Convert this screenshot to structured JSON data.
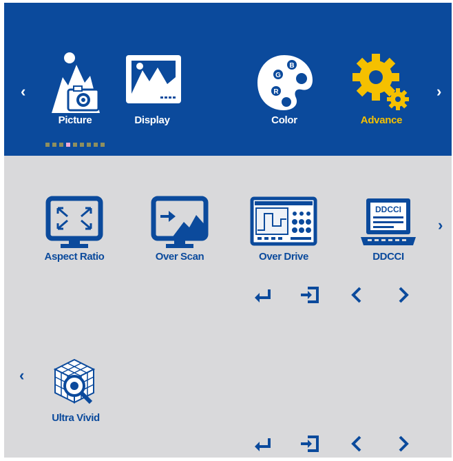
{
  "categories": [
    {
      "label": "Picture",
      "icon": "picture-icon"
    },
    {
      "label": "Display",
      "icon": "display-icon"
    },
    {
      "label": "Color",
      "icon": "color-palette-icon"
    },
    {
      "label": "Advance",
      "icon": "gears-icon"
    }
  ],
  "active_category": "Advance",
  "page_dots": {
    "count": 9,
    "active_index": 3
  },
  "items_row1": [
    {
      "label": "Aspect Ratio",
      "icon": "aspect-ratio-icon"
    },
    {
      "label": "Over Scan",
      "icon": "over-scan-icon"
    },
    {
      "label": "Over Drive",
      "icon": "over-drive-icon"
    },
    {
      "label": "DDCCI",
      "icon": "ddcci-icon"
    }
  ],
  "items_row2": [
    {
      "label": "Ultra Vivid",
      "icon": "ultra-vivid-icon"
    }
  ],
  "ddcci_screen_text": "DDCCI",
  "color_palette_letters": [
    "B",
    "G",
    "R"
  ],
  "key_hints": [
    "enter-icon",
    "exit-icon",
    "left-icon",
    "right-icon"
  ],
  "colors": {
    "brand_blue": "#0b4a9c",
    "active_yellow": "#f5c000",
    "panel_gray": "#d9d9db"
  }
}
